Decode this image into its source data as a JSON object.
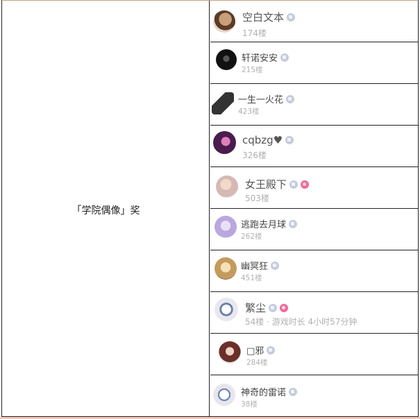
{
  "award": {
    "label": "「学院偶像」奖"
  },
  "colors": {
    "border": "#222222",
    "muted": "#b0b0b0",
    "badge": "#c5ccdc",
    "badge_pink": "#f06a9a"
  },
  "users": [
    {
      "name": "空白文本",
      "meta": "174楼",
      "badges": [
        "level-badge-icon"
      ]
    },
    {
      "name": "轩诺安安",
      "meta": "215楼",
      "badges": [
        "level-badge-icon"
      ]
    },
    {
      "name": "一生一火花",
      "meta": "423楼",
      "badges": [
        "level-badge-icon"
      ]
    },
    {
      "name": "cqbzg♥",
      "meta": "326楼",
      "badges": [
        "level-badge-icon"
      ]
    },
    {
      "name": "女王殿下",
      "meta": "503楼",
      "badges": [
        "level-badge-icon",
        "gender-badge-icon"
      ]
    },
    {
      "name": "逃跑去月球",
      "meta": "262楼",
      "badges": [
        "level-badge-icon"
      ]
    },
    {
      "name": "幽冥狂",
      "meta": "451楼",
      "badges": [
        "level-badge-icon"
      ]
    },
    {
      "name": "繁尘",
      "meta": "54楼 · 游戏时长 4小时57分钟",
      "badges": [
        "level-badge-icon",
        "gender-badge-icon"
      ]
    },
    {
      "name": "□邪",
      "meta": "284楼",
      "badges": [
        "level-badge-icon"
      ]
    },
    {
      "name": "神奇的雷诺",
      "meta": "38楼",
      "badges": [
        "level-badge-icon"
      ]
    }
  ]
}
